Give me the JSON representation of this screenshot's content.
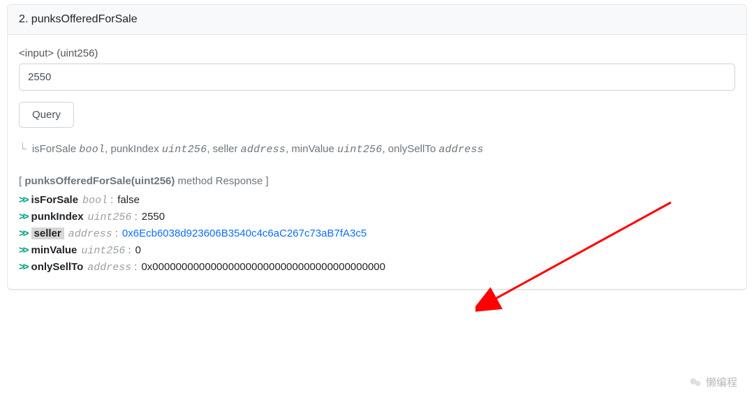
{
  "header": {
    "index": "2.",
    "name": "punksOfferedForSale"
  },
  "input": {
    "label": "<input> (uint256)",
    "value": "2550"
  },
  "query_button": "Query",
  "return_signature": [
    {
      "name": "isForSale",
      "type": "bool"
    },
    {
      "name": "punkIndex",
      "type": "uint256"
    },
    {
      "name": "seller",
      "type": "address"
    },
    {
      "name": "minValue",
      "type": "uint256"
    },
    {
      "name": "onlySellTo",
      "type": "address"
    }
  ],
  "response": {
    "title_prefix": "[ ",
    "title_method": "punksOfferedForSale(uint256)",
    "title_suffix": " method Response ]",
    "rows": [
      {
        "name": "isForSale",
        "type": "bool",
        "value": "false",
        "link": false,
        "highlight": false
      },
      {
        "name": "punkIndex",
        "type": "uint256",
        "value": "2550",
        "link": false,
        "highlight": false
      },
      {
        "name": "seller",
        "type": "address",
        "value": "0x6Ecb6038d923606B3540c4c6aC267c73aB7fA3c5",
        "link": true,
        "highlight": true
      },
      {
        "name": "minValue",
        "type": "uint256",
        "value": "0",
        "link": false,
        "highlight": false
      },
      {
        "name": "onlySellTo",
        "type": "address",
        "value": "0x0000000000000000000000000000000000000000",
        "link": false,
        "highlight": false
      }
    ]
  },
  "watermark": {
    "text": "懒编程"
  },
  "colors": {
    "accentGreen": "#00a186",
    "link": "#0d6efd",
    "arrow": "#ff0000"
  }
}
